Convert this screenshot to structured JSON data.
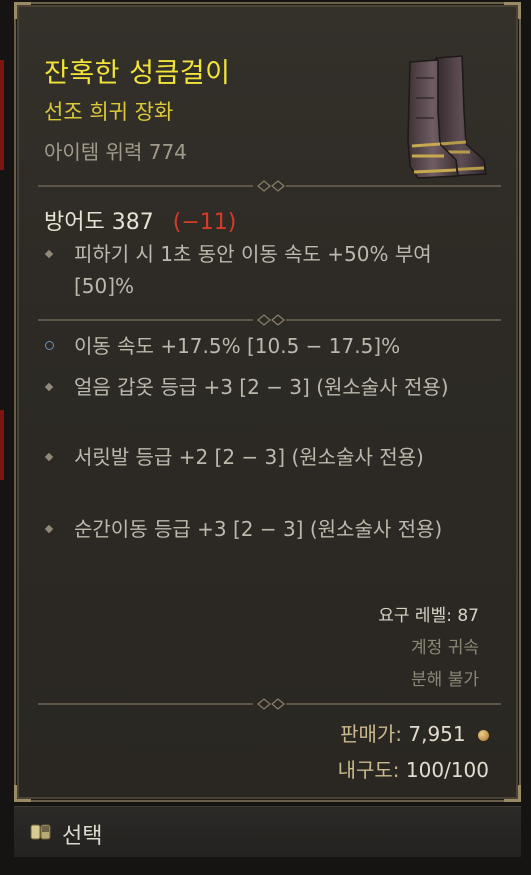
{
  "item": {
    "name": "잔혹한 성큼걸이",
    "rarity": "선조 희귀 장화",
    "power_label": "아이템 위력",
    "power_value": "774"
  },
  "defense": {
    "label": "방어도",
    "value": "387",
    "diff": "(−11)"
  },
  "implicit": [
    {
      "text": "피하기 시 1초 동안 이동 속도 +50% 부여 [50]%"
    }
  ],
  "affixes": [
    {
      "text": "이동 속도 +17.5% [10.5 − 17.5]%"
    },
    {
      "text": "얼음 갑옷 등급 +3 [2 − 3] (원소술사 전용)"
    },
    {
      "text": "서릿발 등급 +2 [2 − 3] (원소술사 전용)"
    },
    {
      "text": "순간이동 등급 +3 [2 − 3] (원소술사 전용)"
    }
  ],
  "requirements": {
    "level_label": "요구 레벨:",
    "level_value": "87",
    "bound": "계정 귀속",
    "salvage": "분해 불가"
  },
  "sell": {
    "label": "판매가:",
    "value": "7,951"
  },
  "durability": {
    "label": "내구도:",
    "value": "100/100"
  },
  "action": {
    "select_label": "선택"
  },
  "colors": {
    "name": "#f2e33a",
    "rarity": "#dcc93a",
    "defense_diff": "#d63a2a",
    "frame": "#6c5f49"
  },
  "icons": {
    "item": "boots-icon",
    "coin": "gold-coin-icon",
    "select": "keyboard-key-icon",
    "magic_affix_bullet": "ring-bullet-icon",
    "affix_bullet": "diamond-bullet-icon"
  }
}
